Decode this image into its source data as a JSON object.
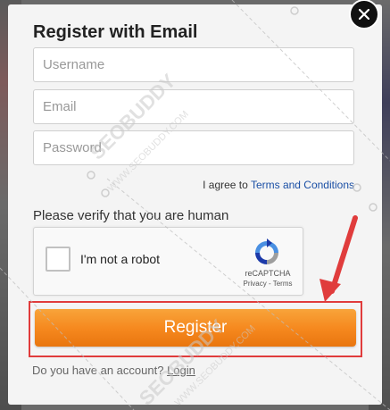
{
  "modal": {
    "title": "Register with Email",
    "username_placeholder": "Username",
    "email_placeholder": "Email",
    "password_placeholder": "Password",
    "terms_prefix": "I agree to ",
    "terms_link": "Terms and Conditions",
    "verify_text": "Please verify that you are human",
    "captcha": {
      "label": "I'm not a robot",
      "brand": "reCAPTCHA",
      "privacy": "Privacy",
      "separator": " - ",
      "terms": "Terms",
      "checked": false
    },
    "register_label": "Register",
    "account_prefix": "Do you have an account? ",
    "login_link": "Login",
    "close_label": "×"
  },
  "watermark": {
    "text": "SEOBUDDY",
    "url": "WWW.SEOBUDDY.COM"
  },
  "colors": {
    "accent_orange": "#f5871d",
    "annotation_red": "#e03c3c",
    "link_blue": "#1a4fa5"
  }
}
